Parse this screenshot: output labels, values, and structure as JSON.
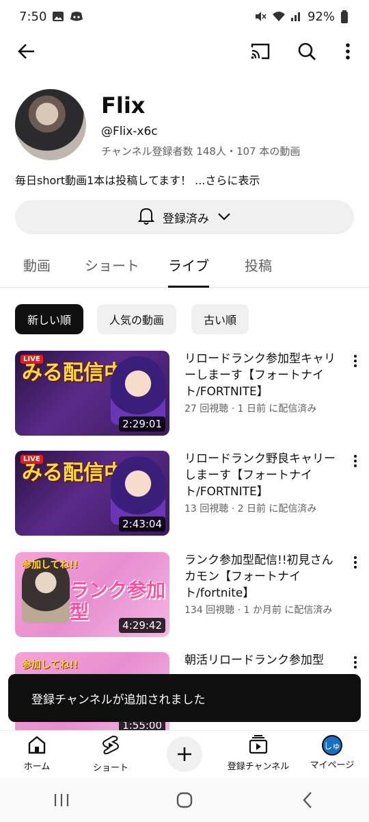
{
  "status_bar": {
    "time": "7:50",
    "battery": "92%"
  },
  "channel": {
    "name": "Flix",
    "handle": "@Flix-x6c",
    "stats": "チャンネル登録者数 148人・107 本の動画",
    "description": "毎日short動画1本は投稿してます！",
    "more": "...さらに表示",
    "subscribe_label": "登録済み"
  },
  "tabs": [
    {
      "label": "動画"
    },
    {
      "label": "ショート"
    },
    {
      "label": "ライブ"
    },
    {
      "label": "投稿"
    }
  ],
  "chips": [
    {
      "label": "新しい順"
    },
    {
      "label": "人気の動画"
    },
    {
      "label": "古い順"
    }
  ],
  "videos": [
    {
      "title": "リロードランク参加型キャリーしまーす【フォートナイト/FORTNITE】",
      "meta": "27 回視聴 · 1 日前 に配信済み",
      "duration": "2:29:01"
    },
    {
      "title": "リロードランク野良キャリーしまーす【フォートナイト/FORTNITE】",
      "meta": "13 回視聴 · 2 日前 に配信済み",
      "duration": "2:43:04"
    },
    {
      "title": "ランク参加型配信!!初見さんカモン【フォートナイト/fortnite】",
      "meta": "134 回視聴 · 1 か月前 に配信済み",
      "duration": "4:29:42"
    },
    {
      "title": "朝活リロードランク参加型",
      "duration": "1:55:00"
    }
  ],
  "thumb_text": {
    "live": "LIVE",
    "stream_title": "みる配信中",
    "sankashite": "参加してね!!",
    "rank": "ランク参加型"
  },
  "snackbar": "登録チャンネルが追加されました",
  "bottom_nav": {
    "home": "ホーム",
    "shorts": "ショート",
    "subscriptions": "登録チャンネル",
    "me": "マイページ",
    "me_avatar": "しゅ"
  },
  "colors": {
    "accent": "#0f0f0f",
    "chip_bg": "#f0f0f0",
    "snackbar_bg": "#0f0f0f"
  }
}
